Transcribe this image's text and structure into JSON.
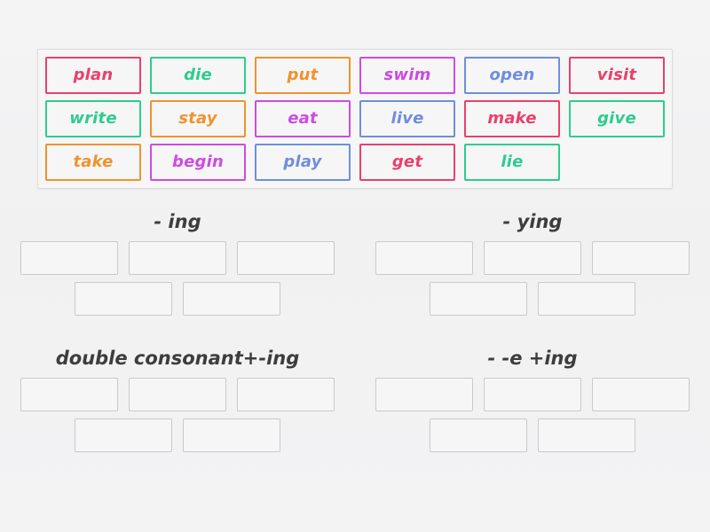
{
  "activity": {
    "type": "group-sort",
    "colors": {
      "crimson": "#e8416a",
      "green": "#2ecc8f",
      "orange": "#f0922e",
      "magenta": "#cc4ce0",
      "blue": "#6e8fdb",
      "slot_border": "#c9c9cb",
      "panel_border": "#dcdcde",
      "page_background": "#f2f2f2",
      "heading_text": "#3d3d3d"
    }
  },
  "word_bank": {
    "tiles": [
      {
        "label": "plan",
        "color": "#e8416a"
      },
      {
        "label": "die",
        "color": "#2ecc8f"
      },
      {
        "label": "put",
        "color": "#f0922e"
      },
      {
        "label": "swim",
        "color": "#cc4ce0"
      },
      {
        "label": "open",
        "color": "#6e8fdb"
      },
      {
        "label": "visit",
        "color": "#e8416a"
      },
      {
        "label": "write",
        "color": "#2ecc8f"
      },
      {
        "label": "stay",
        "color": "#f0922e"
      },
      {
        "label": "eat",
        "color": "#cc4ce0"
      },
      {
        "label": "live",
        "color": "#6e8fdb"
      },
      {
        "label": "make",
        "color": "#e8416a"
      },
      {
        "label": "give",
        "color": "#2ecc8f"
      },
      {
        "label": "take",
        "color": "#f0922e"
      },
      {
        "label": "begin",
        "color": "#cc4ce0"
      },
      {
        "label": "play",
        "color": "#6e8fdb"
      },
      {
        "label": "get",
        "color": "#e8416a"
      },
      {
        "label": "lie",
        "color": "#2ecc8f"
      }
    ]
  },
  "categories": [
    {
      "title": "- ing",
      "slots_row1": 3,
      "slots_row2": 2
    },
    {
      "title": "- ying",
      "slots_row1": 3,
      "slots_row2": 2
    },
    {
      "title": "double consonant+-ing",
      "slots_row1": 3,
      "slots_row2": 2
    },
    {
      "title": "- -e +ing",
      "slots_row1": 3,
      "slots_row2": 2
    }
  ]
}
